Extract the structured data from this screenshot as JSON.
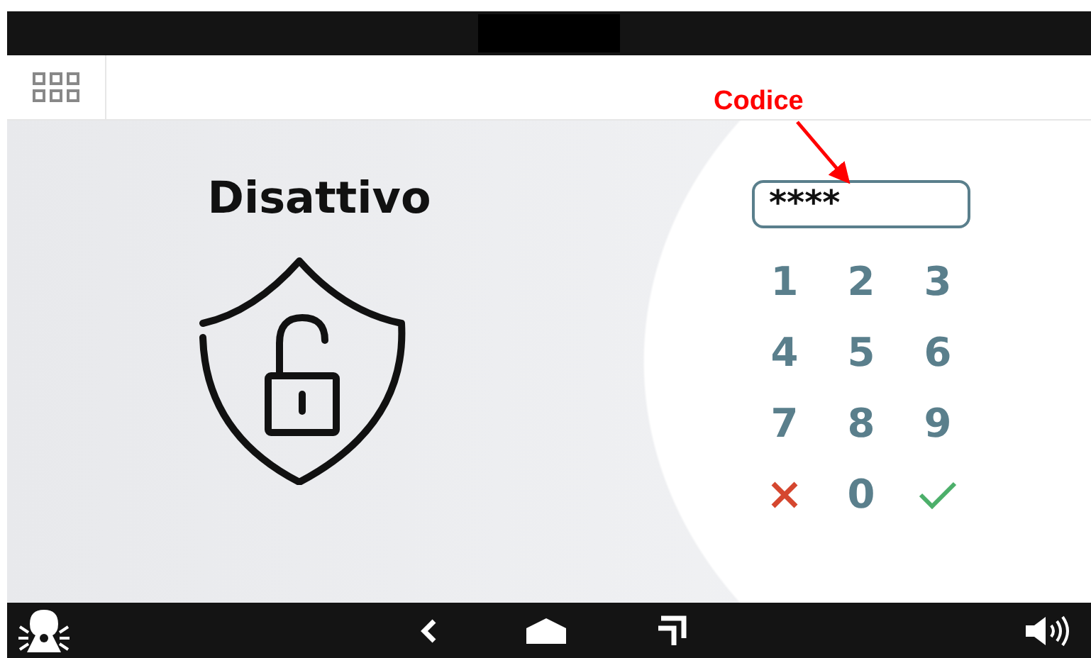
{
  "status": "Disattivo",
  "annotation": {
    "label": "Codice"
  },
  "code_field": {
    "value": "****"
  },
  "keypad": [
    {
      "kind": "digit",
      "label": "1"
    },
    {
      "kind": "digit",
      "label": "2"
    },
    {
      "kind": "digit",
      "label": "3"
    },
    {
      "kind": "digit",
      "label": "4"
    },
    {
      "kind": "digit",
      "label": "5"
    },
    {
      "kind": "digit",
      "label": "6"
    },
    {
      "kind": "digit",
      "label": "7"
    },
    {
      "kind": "digit",
      "label": "8"
    },
    {
      "kind": "digit",
      "label": "9"
    },
    {
      "kind": "cancel"
    },
    {
      "kind": "digit",
      "label": "0"
    },
    {
      "kind": "confirm"
    }
  ]
}
